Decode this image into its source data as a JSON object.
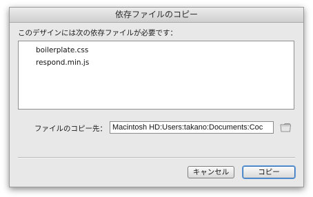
{
  "dialog": {
    "title": "依存ファイルのコピー",
    "requires_label": "このデザインには次の依存ファイルが必要です：",
    "files": [
      "boilerplate.css",
      "respond.min.js"
    ],
    "destination_label": "ファイルのコピー先：",
    "destination_value": "Macintosh HD:Users:takano:Documents:Coc",
    "folder_icon": "folder-icon",
    "cancel_label": "キャンセル",
    "copy_label": "コピー"
  },
  "colors": {
    "dialog_bg": "#e8e8e8",
    "default_button_accent": "#2f6fb8"
  }
}
